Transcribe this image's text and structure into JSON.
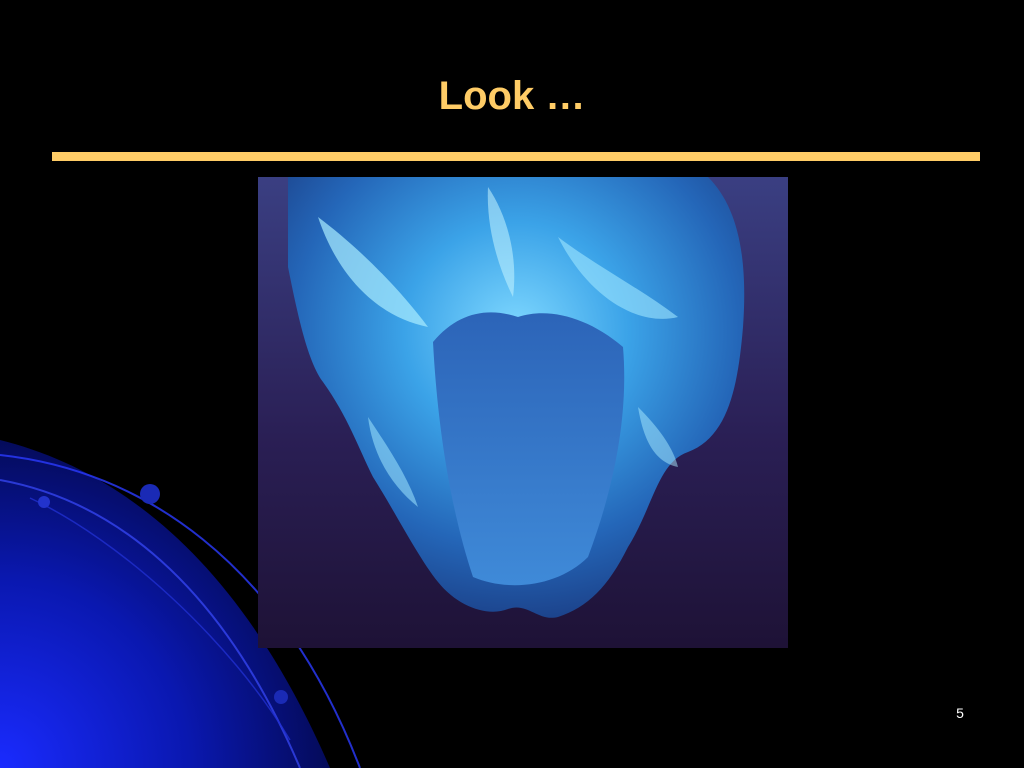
{
  "slide": {
    "title": "Look …",
    "number": "5"
  },
  "colors": {
    "background": "#000000",
    "accent": "#FFCC66",
    "deco_blue": "#0A1FB8"
  },
  "image": {
    "subject": "iceberg-photo"
  }
}
